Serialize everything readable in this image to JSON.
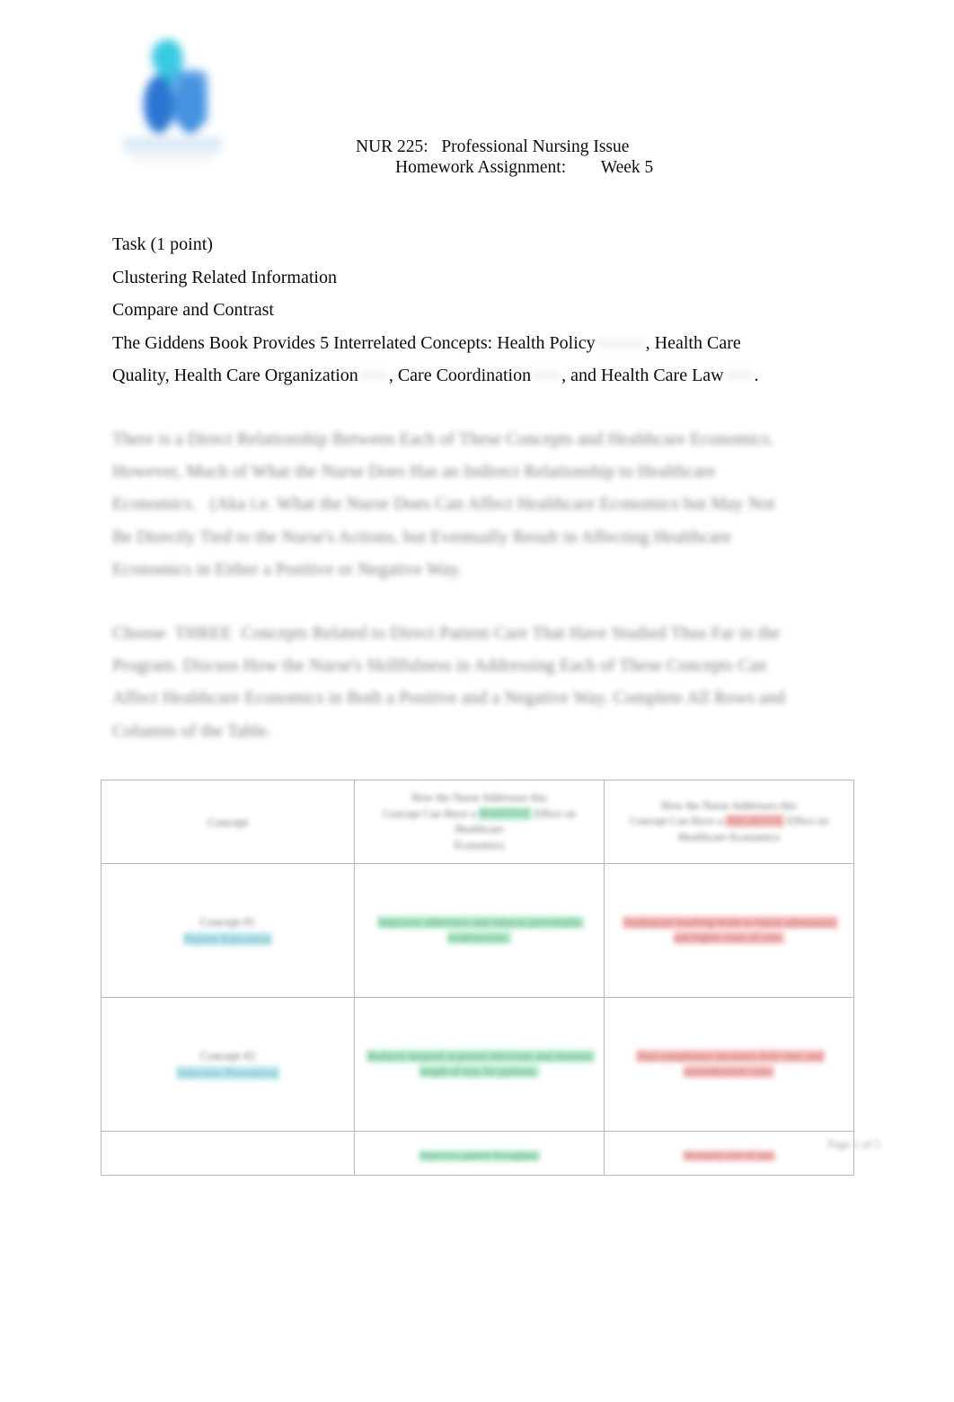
{
  "document": {
    "title_line1": "NUR 225:   Professional Nursing Issue",
    "title_line2": "Homework Assignment:        Week 5",
    "logo_name": "university-logo",
    "page_background": "#ffffff"
  },
  "body": {
    "line_task": "Task (1 point)",
    "line_clustering": "Clustering Related Information",
    "line_compare": "Compare and Contrast",
    "line_giddens_a": "The Giddens Book Provides 5 Interrelated Concepts: Health Policy",
    "line_giddens_b": ", Health Care",
    "line_giddens_c": "Quality",
    "line_giddens_d": ", Health Care Organization",
    "line_giddens_e": ", Care Coordination",
    "line_giddens_f": ", and Health Care Law",
    "line_giddens_g": "."
  },
  "paragraphs": {
    "relationship": "There is a Direct Relationship Between Each of These Concepts and Healthcare Economics. However, Much of What the Nurse Does Has an Indirect Relationship to Healthcare Economics.   (Aka i.e. What the Nurse Does Can Affect Healthcare Economics but May Not Be Directly Tied to the Nurse's Actions, but Eventually Result in Affecting Healthcare Economics in Either a Positive or Negative Way.",
    "concepts": "Choose  THREE  Concepts Related to Direct Patient Care That Have Studied Thus Far in the Program. Discuss How the Nurse's Skillfulness in Addressing Each of These Concepts Can Affect Healthcare Economics in Both a Positive and a Negative Way. Complete All Rows and Columns of the Table."
  },
  "table": {
    "headers": {
      "col1": "Concept",
      "col2_line1": "How the Nurse Addresses this",
      "col2_line2": "Concept Can Have a",
      "col2_highlight": "POSITIVE",
      "col2_line3": "Effect on Healthcare",
      "col2_line4": "Economics",
      "col3_line1": "How the Nurse Addresses this",
      "col3_line2": "Concept Can Have a",
      "col3_highlight": "NEGATIVE",
      "col3_line3": "Effect on",
      "col3_line4": "Healthcare Economics"
    },
    "rows": [
      {
        "concept_label": "Concept #1",
        "concept_name": "Patient Education",
        "positive": "Improves adherence and reduces preventable readmissions.",
        "negative": "Inadequate teaching leads to repeat admissions and higher costs of care."
      },
      {
        "concept_label": "Concept #2",
        "concept_name": "Infection Prevention",
        "positive": "Reduces hospital acquired infections and shortens length of stay for patients.",
        "negative": "Non-compliance increases HAI rates and unreimbursed costs."
      },
      {
        "concept_label": "",
        "concept_name": "",
        "positive": "Improves patient throughput",
        "negative": "Increases cost of care"
      }
    ]
  },
  "footer": {
    "page_number": "Page 1 of 2",
    "mark": "university-watermark"
  },
  "colors": {
    "highlight_green": "#9be6bd",
    "highlight_red": "#f7a7a7",
    "highlight_cyan": "#a8e3ea",
    "text_green": "#5fc491",
    "text_red": "#e78d8d",
    "text_cyan": "#7ec9d4",
    "table_border": "#b9b9b9",
    "logo_blue": "#1f6fd0",
    "logo_cyan": "#2ec8e0"
  }
}
